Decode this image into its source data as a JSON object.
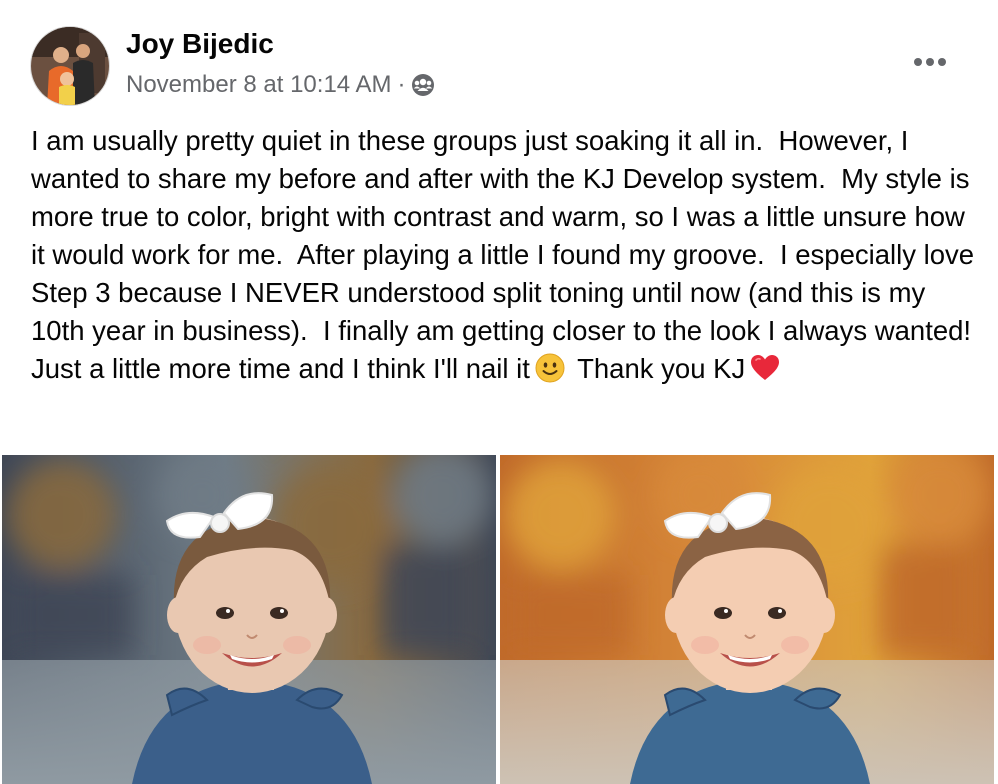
{
  "post": {
    "author_name": "Joy Bijedic",
    "timestamp": "November 8 at 10:14 AM",
    "separator": "·",
    "audience_icon": "group-members-icon",
    "more_icon": "more-options-icon",
    "text_part1": "I am usually pretty quiet in these groups just soaking it all in.  However, I wanted to share my before and after with the KJ Develop system.  My style is more true to color, bright with contrast and warm, so I was a little unsure how it would work for me.  After playing a little I found my groove.  I especially love Step 3 because I NEVER understood split toning until now (and this is my 10th year in business).  I finally am getting closer to the look I always wanted!  Just a little more time and I think I'll nail it",
    "emoji_smile": "slightly-smiling-face-emoji",
    "text_part2": "Thank you KJ",
    "emoji_heart": "red-heart-emoji"
  },
  "photos": [
    {
      "name": "before-photo",
      "palette": {
        "bg1": "#3f4756",
        "bg2": "#8a6a3e",
        "bg3": "#6f7c86",
        "ground": "#8f9aa2",
        "shirt": "#3b5f8a",
        "skin": "#e9c8b1",
        "hair": "#7a5a3e"
      }
    },
    {
      "name": "after-photo",
      "palette": {
        "bg1": "#c06a2a",
        "bg2": "#e0a23a",
        "bg3": "#d88a3a",
        "ground": "#cdc2b4",
        "shirt": "#3e6a93",
        "skin": "#f4cdb2",
        "hair": "#8b6344"
      }
    }
  ]
}
